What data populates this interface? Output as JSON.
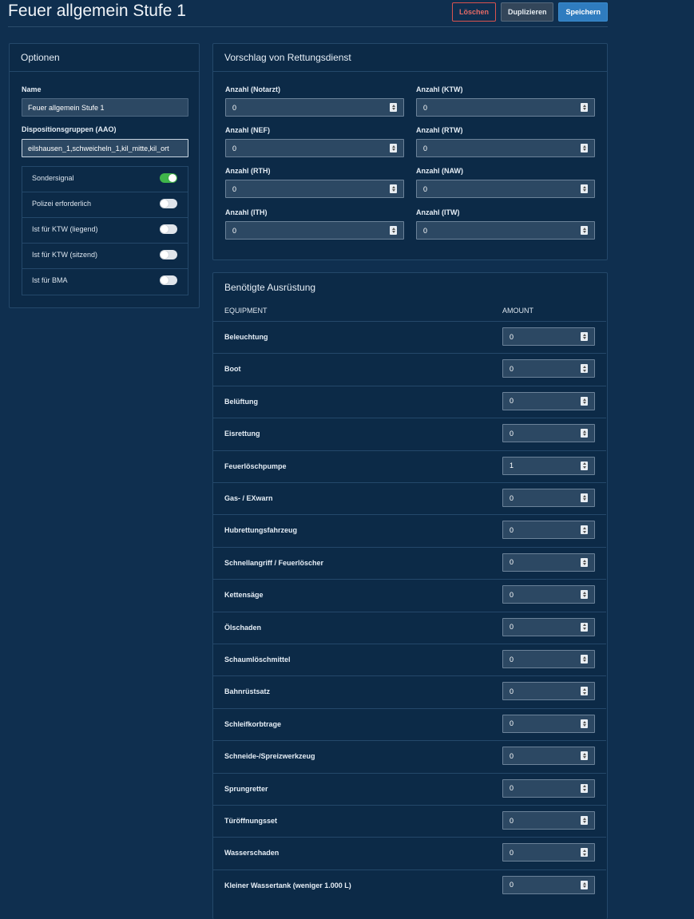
{
  "header": {
    "title": "Feuer allgemein Stufe 1",
    "delete_label": "Löschen",
    "duplicate_label": "Duplizieren",
    "save_label": "Speichern"
  },
  "options": {
    "heading": "Optionen",
    "name_label": "Name",
    "name_value": "Feuer allgemein Stufe 1",
    "groups_label": "Dispositionsgruppen (AAO)",
    "groups_value": "eilshausen_1,schweicheln_1,kil_mitte,kil_ort",
    "toggles": [
      {
        "label": "Sondersignal",
        "on": true
      },
      {
        "label": "Polizei erforderlich",
        "on": false
      },
      {
        "label": "Ist für KTW (liegend)",
        "on": false
      },
      {
        "label": "Ist für KTW (sitzend)",
        "on": false
      },
      {
        "label": "Ist für BMA",
        "on": false
      }
    ]
  },
  "rescue": {
    "heading": "Vorschlag von Rettungsdienst",
    "fields": [
      {
        "label": "Anzahl (Notarzt)",
        "value": "0"
      },
      {
        "label": "Anzahl (KTW)",
        "value": "0"
      },
      {
        "label": "Anzahl (NEF)",
        "value": "0"
      },
      {
        "label": "Anzahl (RTW)",
        "value": "0"
      },
      {
        "label": "Anzahl (RTH)",
        "value": "0"
      },
      {
        "label": "Anzahl (NAW)",
        "value": "0"
      },
      {
        "label": "Anzahl (ITH)",
        "value": "0"
      },
      {
        "label": "Anzahl (ITW)",
        "value": "0"
      }
    ]
  },
  "equipment": {
    "heading": "Benötigte Ausrüstung",
    "col_equipment": "EQUIPMENT",
    "col_amount": "AMOUNT",
    "rows": [
      {
        "name": "Beleuchtung",
        "amount": "0"
      },
      {
        "name": "Boot",
        "amount": "0"
      },
      {
        "name": "Belüftung",
        "amount": "0"
      },
      {
        "name": "Eisrettung",
        "amount": "0"
      },
      {
        "name": "Feuerlöschpumpe",
        "amount": "1"
      },
      {
        "name": "Gas- / EXwarn",
        "amount": "0"
      },
      {
        "name": "Hubrettungsfahrzeug",
        "amount": "0"
      },
      {
        "name": "Schnellangriff / Feuerlöscher",
        "amount": "0"
      },
      {
        "name": "Kettensäge",
        "amount": "0"
      },
      {
        "name": "Ölschaden",
        "amount": "0"
      },
      {
        "name": "Schaumlöschmittel",
        "amount": "0"
      },
      {
        "name": "Bahnrüstsatz",
        "amount": "0"
      },
      {
        "name": "Schleifkorbtrage",
        "amount": "0"
      },
      {
        "name": "Schneide-/Spreizwerkzeug",
        "amount": "0"
      },
      {
        "name": "Sprungretter",
        "amount": "0"
      },
      {
        "name": "Türöffnungsset",
        "amount": "0"
      },
      {
        "name": "Wasserschaden",
        "amount": "0"
      },
      {
        "name": "Kleiner Wassertank (weniger 1.000 L)",
        "amount": "0"
      }
    ]
  }
}
